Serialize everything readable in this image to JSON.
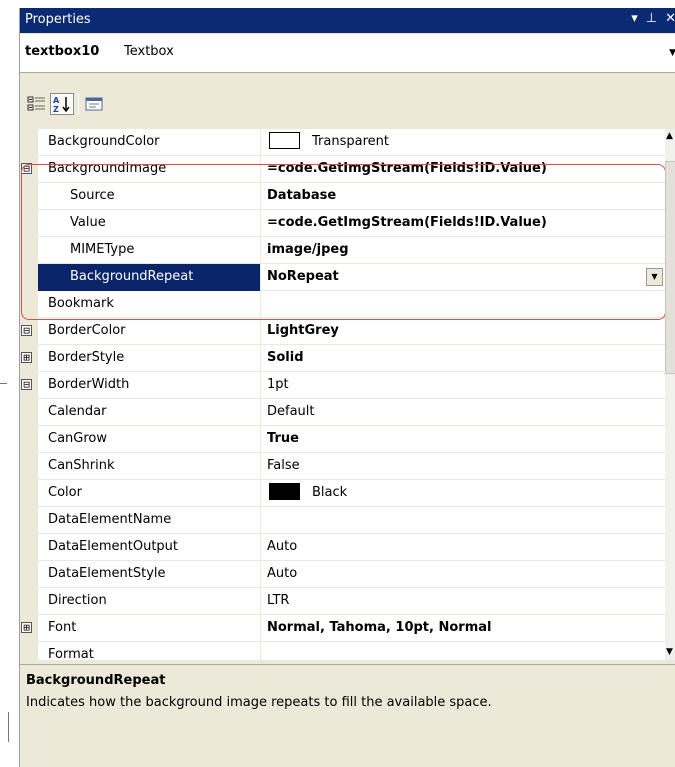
{
  "titlebar": {
    "title": "Properties",
    "dropdown_glyph": "▾",
    "pin_glyph": "⊥",
    "close_glyph": "✕"
  },
  "object_selector": {
    "name": "textbox10",
    "type": "Textbox"
  },
  "toolbar": {
    "buttons": [
      {
        "name": "categorized-icon",
        "active": false
      },
      {
        "name": "alphabetical-sort-icon",
        "active": true
      },
      {
        "name": "property-pages-icon",
        "active": false
      }
    ]
  },
  "properties": [
    {
      "name": "BackgroundColor",
      "value": "Transparent",
      "swatch": "#ffffff"
    },
    {
      "name": "BackgroundImage",
      "value": "=code.GetImgStream(Fields!ID.Value)",
      "expander": "⊟",
      "bold": true
    },
    {
      "name": "Source",
      "value": "Database",
      "child": true,
      "bold": true
    },
    {
      "name": "Value",
      "value": "=code.GetImgStream(Fields!ID.Value)",
      "child": true,
      "bold": true
    },
    {
      "name": "MIMEType",
      "value": "image/jpeg",
      "child": true,
      "bold": true
    },
    {
      "name": "BackgroundRepeat",
      "value": "NoRepeat",
      "child": true,
      "bold": true,
      "selected": true,
      "dropdown": true
    },
    {
      "name": "Bookmark",
      "value": ""
    },
    {
      "name": "BorderColor",
      "value": "LightGrey",
      "expander": "⊟",
      "bold": true
    },
    {
      "name": "BorderStyle",
      "value": "Solid",
      "expander": "⊞",
      "bold": true
    },
    {
      "name": "BorderWidth",
      "value": "1pt",
      "expander": "⊟"
    },
    {
      "name": "Calendar",
      "value": "Default"
    },
    {
      "name": "CanGrow",
      "value": "True",
      "bold": true
    },
    {
      "name": "CanShrink",
      "value": "False"
    },
    {
      "name": "Color",
      "value": "Black",
      "swatch": "#000000"
    },
    {
      "name": "DataElementName",
      "value": ""
    },
    {
      "name": "DataElementOutput",
      "value": "Auto"
    },
    {
      "name": "DataElementStyle",
      "value": "Auto"
    },
    {
      "name": "Direction",
      "value": "LTR"
    },
    {
      "name": "Font",
      "value": "Normal, Tahoma, 10pt, Normal",
      "expander": "⊞",
      "bold": true
    },
    {
      "name": "Format",
      "value": ""
    }
  ],
  "description": {
    "title": "BackgroundRepeat",
    "text": "Indicates how the background image repeats to fill the available space."
  },
  "colors": {
    "title_bar": "#0a2a74",
    "selection": "#0a246a",
    "highlight_outline": "#e04a4a",
    "panel": "#ece9d8"
  }
}
